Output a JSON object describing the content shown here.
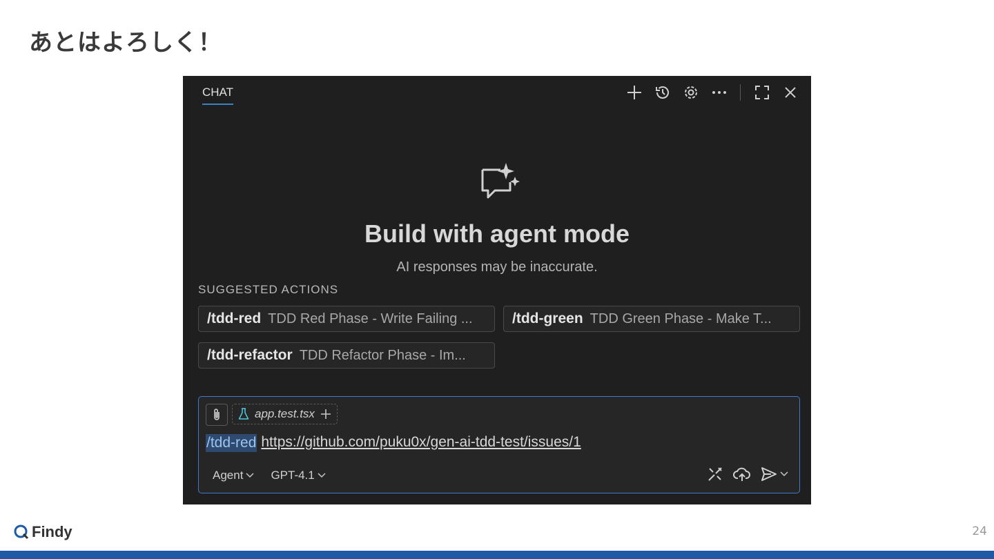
{
  "slide": {
    "title": "あとはよろしく！",
    "page_number": "24",
    "brand": "Findy"
  },
  "chat_panel": {
    "tab_label": "CHAT",
    "toolbar_icons": [
      "plus-icon",
      "history-icon",
      "gear-icon",
      "more-icon",
      "maximize-icon",
      "close-icon"
    ],
    "hero": {
      "icon": "chat-sparkle-icon",
      "title": "Build with agent mode",
      "subtitle": "AI responses may be inaccurate."
    },
    "suggested_actions": {
      "label": "SUGGESTED ACTIONS",
      "items": [
        {
          "command": "/tdd-red",
          "description": "TDD Red Phase - Write Failing ..."
        },
        {
          "command": "/tdd-green",
          "description": "TDD Green Phase - Make T..."
        },
        {
          "command": "/tdd-refactor",
          "description": "TDD Refactor Phase - Im..."
        }
      ]
    },
    "input": {
      "attached_file": "app.test.tsx",
      "command": "/tdd-red",
      "text": "https://github.com/puku0x/gen-ai-tdd-test/issues/1",
      "mode": "Agent",
      "model": "GPT-4.1"
    }
  },
  "colors": {
    "panel_bg": "#1f1f1f",
    "accent": "#3f7bd1",
    "footer_bar": "#1e5aa6"
  }
}
